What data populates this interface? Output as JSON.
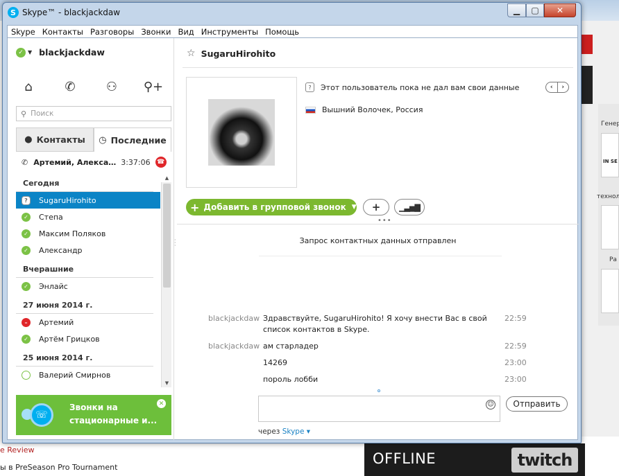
{
  "window": {
    "title": "Skype™ - blackjackdaw"
  },
  "menu": [
    "Skype",
    "Контакты",
    "Разговоры",
    "Звонки",
    "Вид",
    "Инструменты",
    "Помощь"
  ],
  "profile": {
    "name": "blackjackdaw"
  },
  "search": {
    "placeholder": "Поиск"
  },
  "tabs": {
    "contacts": "Контакты",
    "recent": "Последние"
  },
  "active_call": {
    "names": "Артемий, Александр",
    "time": "3:37:06"
  },
  "contact_groups": [
    {
      "title": "Сегодня",
      "contacts": [
        {
          "name": "SugaruHirohito",
          "status": "unknown",
          "selected": true
        },
        {
          "name": "Степа",
          "status": "online"
        },
        {
          "name": "Максим Поляков",
          "status": "online"
        },
        {
          "name": "Александр",
          "status": "online"
        }
      ]
    },
    {
      "title": "Вчерашние",
      "contacts": [
        {
          "name": "Энлайс",
          "status": "online"
        }
      ]
    },
    {
      "title": "27 июня 2014 г.",
      "contacts": [
        {
          "name": "Артемий",
          "status": "dnd"
        },
        {
          "name": "Артём Грицков",
          "status": "online"
        }
      ]
    },
    {
      "title": "25 июня 2014 г.",
      "contacts": [
        {
          "name": "Валерий Смирнов",
          "status": "offline"
        }
      ]
    }
  ],
  "promo": {
    "line1": "Звонки на",
    "line2": "стационарные и..."
  },
  "conversation": {
    "name": "SugaruHirohito",
    "info_unavailable": "Этот пользователь пока не дал вам свои данные",
    "location": "Вышний Волочек, Россия",
    "add_to_call": "Добавить в групповой звонок",
    "request_sent": "Запрос контактных данных отправлен",
    "messages": [
      {
        "sender": "blackjackdaw",
        "text": "Здравствуйте, SugaruHirohito! Я хочу внести Вас в свой список контактов в Skype.",
        "time": "22:59"
      },
      {
        "sender": "blackjackdaw",
        "text": "ам старладер",
        "time": "22:59"
      },
      {
        "sender": "",
        "text": "14269",
        "time": "23:00"
      },
      {
        "sender": "",
        "text": "пороль лобби",
        "time": "23:00"
      }
    ],
    "send_label": "Отправить",
    "via_prefix": "через",
    "via_service": "Skype"
  },
  "background": {
    "label_gen": "Генер",
    "label_in_se": "IN SE",
    "label_tech": "техноло",
    "label_ra": "Ра",
    "link_review": "e Review",
    "link_preseason": "ы в PreSeason Pro Tournament",
    "twitch_offline": "OFFLINE",
    "twitch_logo": "twitch"
  },
  "colors": {
    "accent_blue": "#0b84c6",
    "online_green": "#7cc246",
    "add_call_green": "#7cb82f",
    "promo_green": "#6dbf3b",
    "dnd_red": "#e0262a"
  }
}
